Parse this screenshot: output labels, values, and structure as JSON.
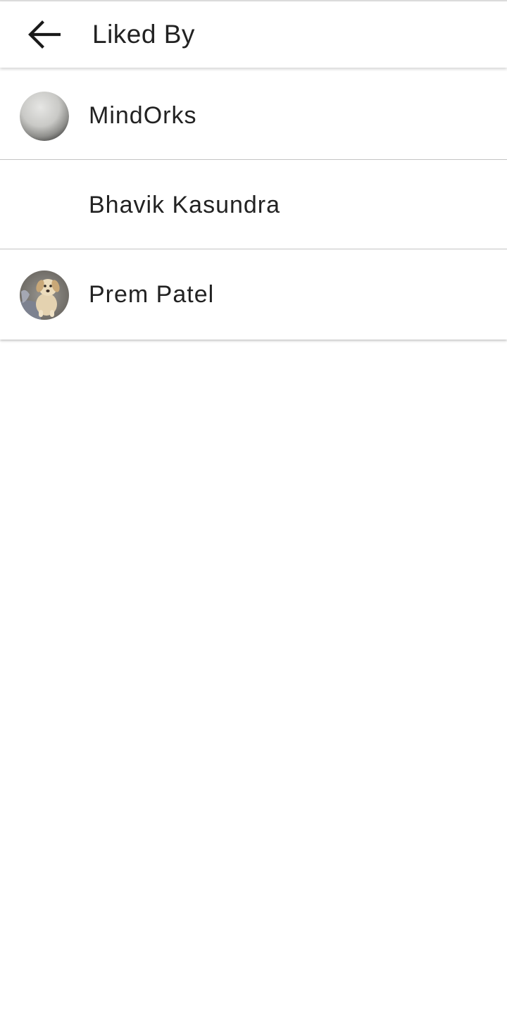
{
  "app_bar": {
    "back_icon": "arrow-back-icon",
    "title": "Liked By"
  },
  "likes": [
    {
      "name": "MindOrks",
      "avatar": "grey-sphere-avatar"
    },
    {
      "name": "Bhavik Kasundra",
      "avatar": ""
    },
    {
      "name": "Prem Patel",
      "avatar": "puppy-photo-avatar"
    }
  ]
}
